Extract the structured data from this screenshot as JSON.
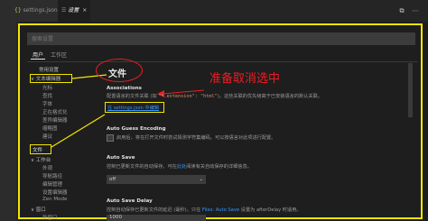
{
  "tabs": [
    {
      "label": "settings.json"
    },
    {
      "label": "设置",
      "close": "×"
    }
  ],
  "toolbar": {
    "open_json_icon": "⧉",
    "more_icon": "⋯"
  },
  "search": {
    "placeholder": "搜索设置"
  },
  "scope_tabs": [
    {
      "label": "用户"
    },
    {
      "label": "工作区"
    }
  ],
  "tree": {
    "common": "常用设置",
    "text_editor": "文本编辑器",
    "text_editor_children": [
      "光标",
      "查找",
      "字体",
      "正在格式化",
      "差异编辑器",
      "缩略图",
      "建议",
      "文件"
    ],
    "workbench": "工作台",
    "workbench_children": [
      "外观",
      "导航路径",
      "编辑管理",
      "设置编辑器",
      "Zen Mode"
    ],
    "window": "窗口",
    "window_children": [
      "新窗口"
    ],
    "arrow_open": "∨",
    "arrow_closed": "›"
  },
  "main": {
    "heading": "文件",
    "associations": {
      "title": "Associations",
      "desc_prefix": "配置语言的文件关联 (如 ",
      "desc_code": "\"*.extension\": \"html\"",
      "desc_suffix": ")。这些关联的优先级高于已安装语言的默认关联。",
      "link": "在 settings.json 中编辑"
    },
    "auto_guess": {
      "title": "Auto Guess Encoding",
      "desc": "启用后，将在打开文件时尝试猜测字符集编码。可以按语言对此项进行配置。"
    },
    "auto_save": {
      "title": "Auto Save",
      "desc_prefix": "控制已更新文件的自动保存。可在",
      "desc_link": "此处",
      "desc_suffix": "阅读有关自动保存的详细信息。",
      "value": "off"
    },
    "auto_save_delay": {
      "title": "Auto Save Delay",
      "desc_prefix": "控制自动保存已更新文件的延迟 (毫秒)。只在 ",
      "desc_link": "Files: Auto Save",
      "desc_suffix": " 设置为 afterDelay 时适用。",
      "value": "1000"
    }
  },
  "annotation": {
    "text": "准备取消选中",
    "color": "#ee1c24",
    "box_color": "#f4e600"
  }
}
